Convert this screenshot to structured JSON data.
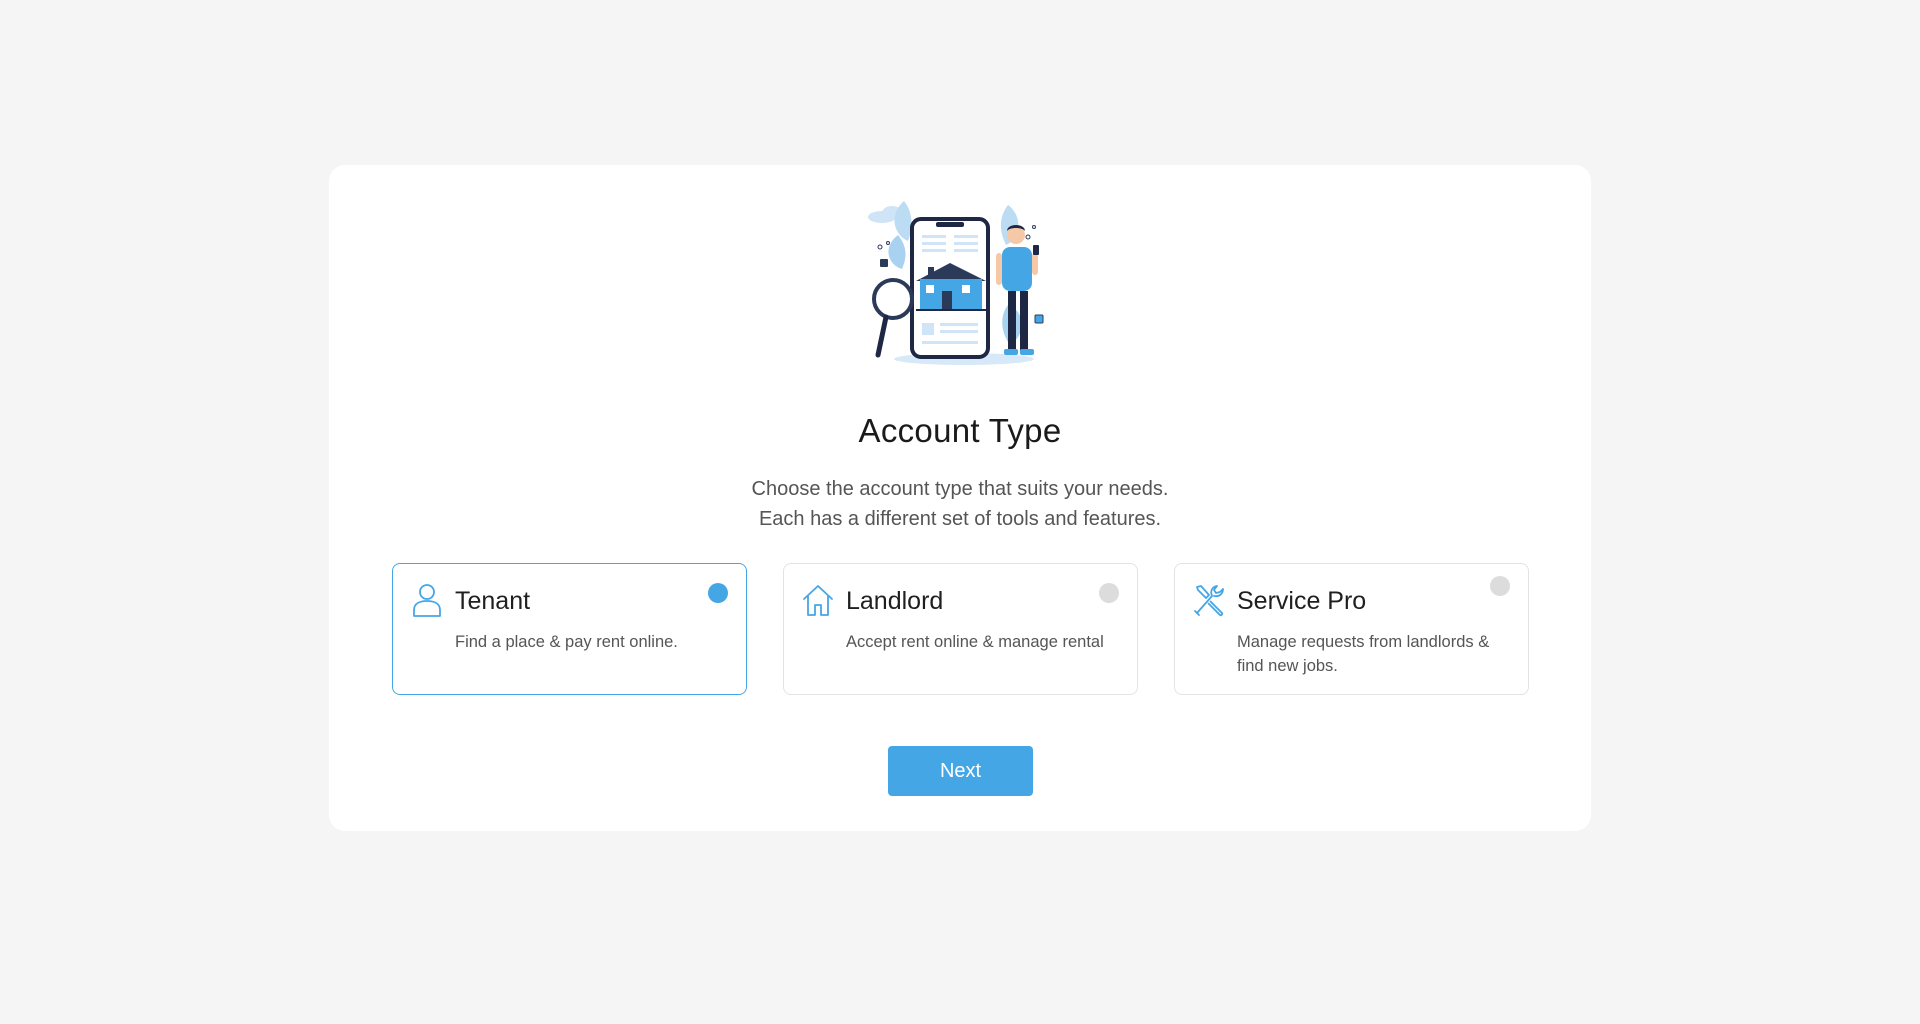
{
  "header": {
    "title": "Account Type",
    "subtitle_line1": "Choose the account type that suits your needs.",
    "subtitle_line2": "Each has a different set of tools and features."
  },
  "options": [
    {
      "label": "Tenant",
      "description": "Find a place & pay rent online.",
      "icon": "user-icon",
      "selected": true
    },
    {
      "label": "Landlord",
      "description": "Accept rent online & manage rental",
      "icon": "house-icon",
      "selected": false
    },
    {
      "label": "Service Pro",
      "description": "Manage requests from landlords & find new jobs.",
      "icon": "tools-icon",
      "selected": false
    }
  ],
  "actions": {
    "next_label": "Next"
  },
  "colors": {
    "accent": "#45a6e6",
    "background": "#f4f5f4",
    "card": "#ffffff",
    "radio_inactive": "#dcdcdc"
  }
}
